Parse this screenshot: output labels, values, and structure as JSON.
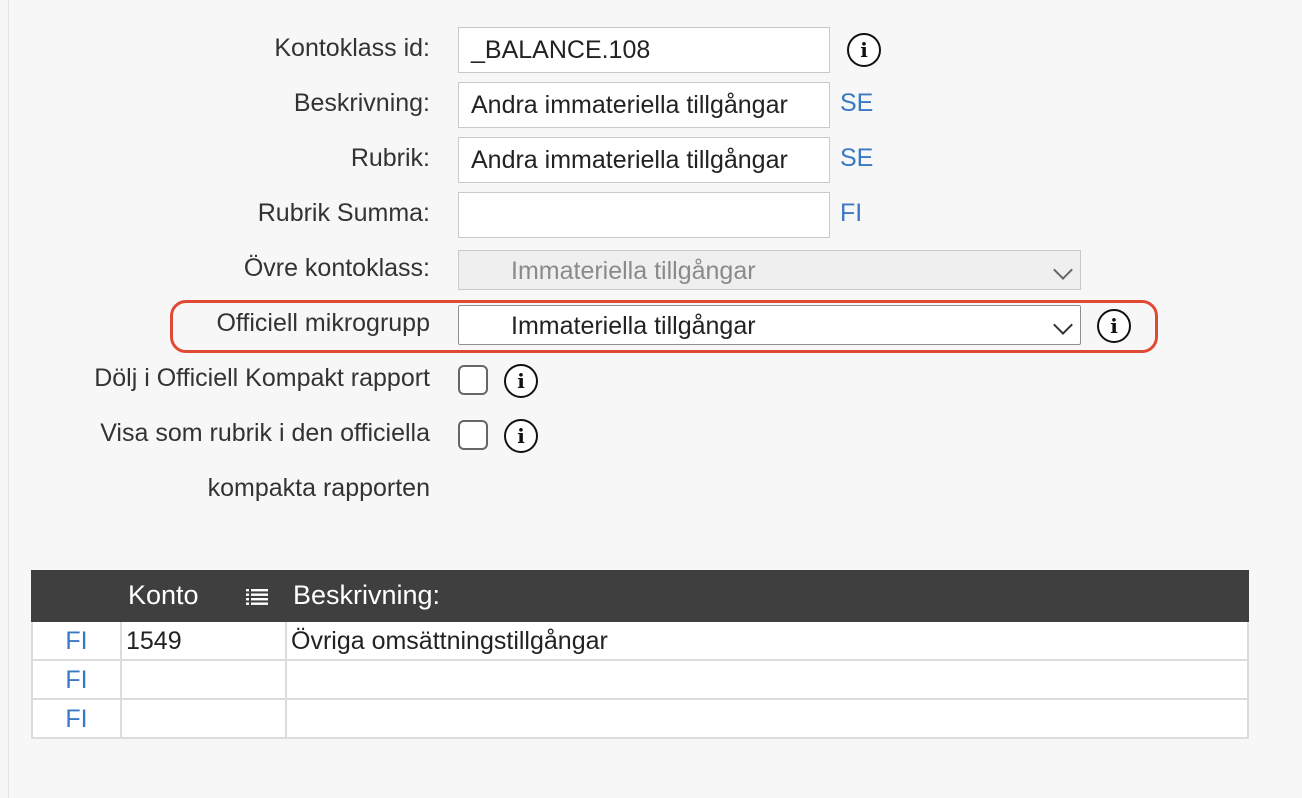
{
  "form": {
    "kontoklass_id": {
      "label": "Kontoklass id:",
      "value": "_BALANCE.108"
    },
    "beskrivning": {
      "label": "Beskrivning:",
      "value": "Andra immateriella tillgångar",
      "lang": "SE"
    },
    "rubrik": {
      "label": "Rubrik:",
      "value": "Andra immateriella tillgångar",
      "lang": "SE"
    },
    "rubrik_summa": {
      "label": "Rubrik Summa:",
      "value": "",
      "lang": "FI"
    },
    "ovre_kontoklass": {
      "label": "Övre kontoklass:",
      "selected": "Immateriella tillgångar"
    },
    "officiell_mikrogrupp": {
      "label": "Officiell mikrogrupp",
      "selected": "Immateriella tillgångar"
    },
    "dolj_kompakt": {
      "label": "Dölj i Officiell Kompakt rapport",
      "checked": false
    },
    "visa_rubrik": {
      "label_line1": "Visa som rubrik i den officiella",
      "label_line2": "kompakta rapporten",
      "checked": false
    },
    "info_glyph": "i"
  },
  "table": {
    "headers": {
      "konto": "Konto",
      "beskrivning": "Beskrivning:"
    },
    "rows": [
      {
        "lang": "FI",
        "konto": "1549",
        "beskrivning": "Övriga omsättningstillgångar"
      },
      {
        "lang": "FI",
        "konto": "",
        "beskrivning": ""
      },
      {
        "lang": "FI",
        "konto": "",
        "beskrivning": ""
      }
    ]
  },
  "colors": {
    "link_blue": "#3a78c3",
    "highlight_red": "#e04a35",
    "table_header_bg": "#3f3f3f"
  },
  "icons": [
    "info-icon",
    "chevron-down-icon",
    "list-sort-icon"
  ]
}
